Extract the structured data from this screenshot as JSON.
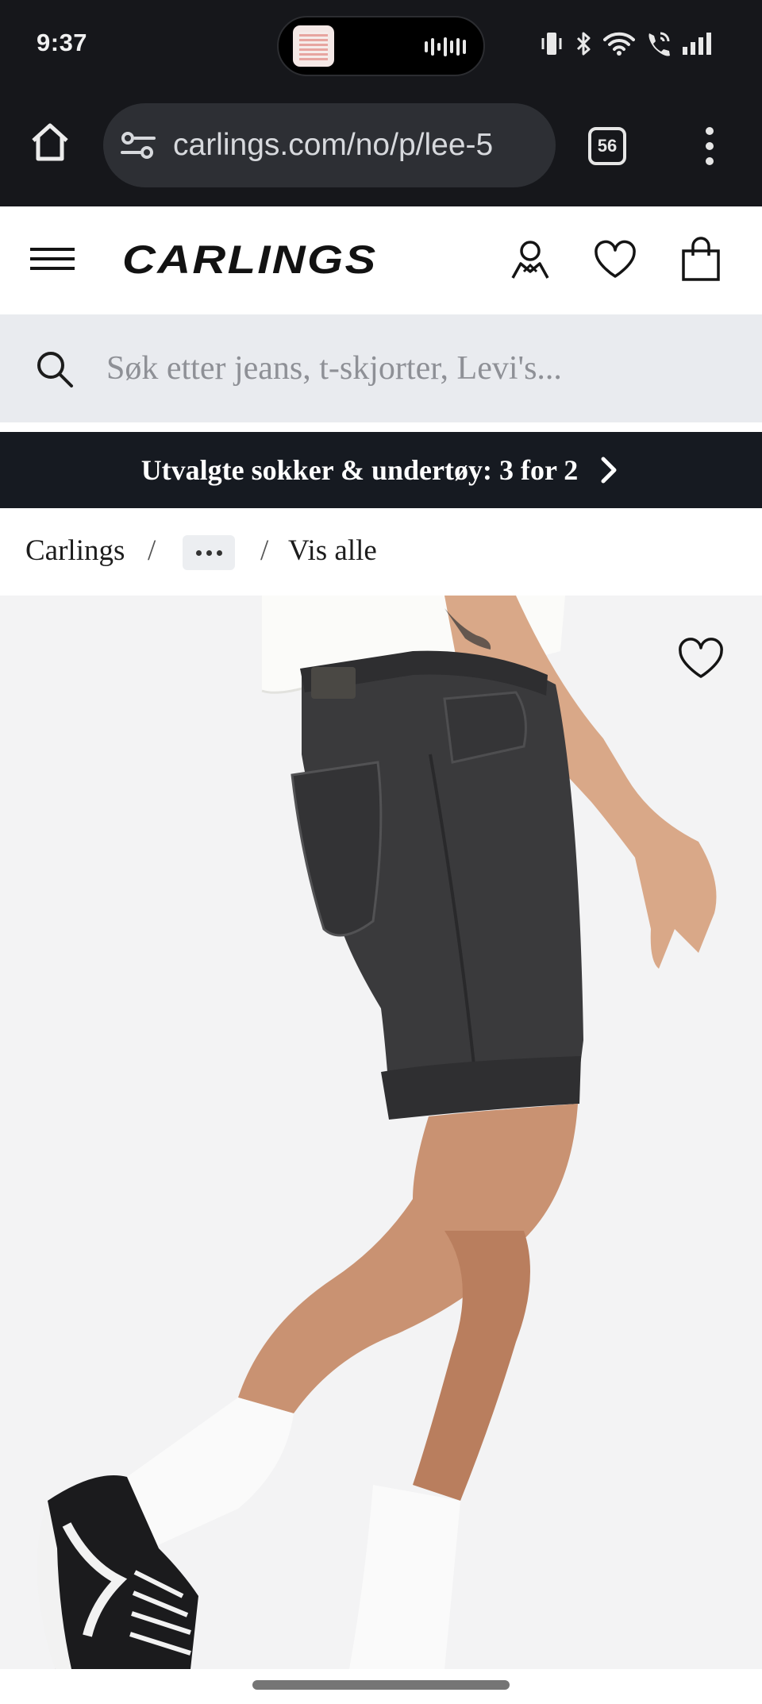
{
  "status_bar": {
    "time": "9:37",
    "icons": [
      "vibrate-icon",
      "bluetooth-icon",
      "wifi-icon",
      "wifi-calling-icon",
      "signal-icon"
    ]
  },
  "browser": {
    "url": "carlings.com/no/p/lee-5",
    "tab_count": "56",
    "icons": [
      "home-icon",
      "site-settings-icon",
      "more-vert-icon"
    ]
  },
  "header": {
    "logo": "CARLINGS",
    "icons": [
      "menu-icon",
      "account-icon",
      "wishlist-icon",
      "cart-icon"
    ]
  },
  "search": {
    "placeholder": "Søk etter jeans, t-skjorter, Levi's...",
    "value": ""
  },
  "promo": {
    "text": "Utvalgte sokker & undertøy: 3 for 2"
  },
  "breadcrumb": {
    "items": [
      "Carlings",
      "Vis alle"
    ],
    "separator": "/"
  },
  "colors": {
    "chrome_bg": "#16171b",
    "promo_bg": "#161a21",
    "search_bg": "#e9ebef",
    "image_bg": "#f3f3f4"
  }
}
